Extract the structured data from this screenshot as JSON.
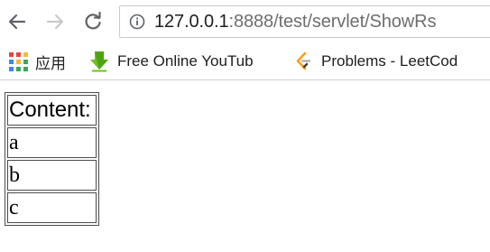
{
  "browser": {
    "url_host": "127.0.0.1",
    "url_rest": ":8888/test/servlet/ShowRs"
  },
  "bookmarks": [
    {
      "label": "应用",
      "icon": "apps-grid-icon"
    },
    {
      "label": "Free Online YouTub",
      "icon": "green-download-arrow-icon"
    },
    {
      "label": "Problems - LeetCod",
      "icon": "leetcode-icon"
    }
  ],
  "table": {
    "header": "Content:",
    "rows": [
      "a",
      "b",
      "c"
    ]
  },
  "colors": {
    "toolbar_icon": "#5f6368",
    "forward_disabled": "#c8c8c8",
    "table_border": "#4d4d4d",
    "leetcode_orange": "#f89f1b",
    "download_green": "#6cc21e"
  }
}
